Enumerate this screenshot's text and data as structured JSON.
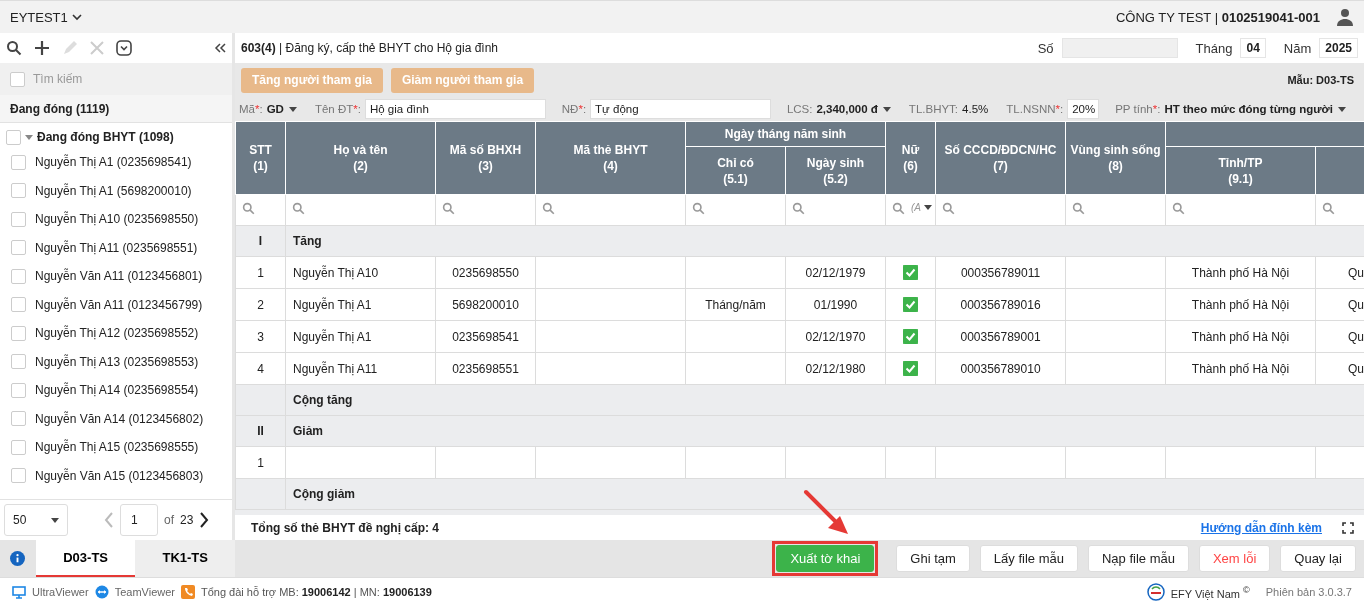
{
  "top_bar": {
    "account": "EYTEST1",
    "company": "CÔNG TY TEST | **0102519041-001**"
  },
  "sidebar": {
    "search": {
      "placeholder": "Tìm kiếm",
      "checked": false
    },
    "group_title": "Đang đóng (1119)",
    "tree": {
      "label": "Đang đóng BHYT (1098)",
      "checked": false,
      "expanded": true,
      "children": [
        {
          "label": "Nguyễn Thị A1 (0235698541)",
          "checked": false
        },
        {
          "label": "Nguyễn Thị A1 (5698200010)",
          "checked": false
        },
        {
          "label": "Nguyễn Thị A10 (0235698550)",
          "checked": false
        },
        {
          "label": "Nguyễn Thị A11 (0235698551)",
          "checked": false
        },
        {
          "label": "Nguyễn Văn A11 (0123456801)",
          "checked": false
        },
        {
          "label": "Nguyễn Văn A11 (0123456799)",
          "checked": false
        },
        {
          "label": "Nguyễn Thị A12 (0235698552)",
          "checked": false
        },
        {
          "label": "Nguyễn Thị A13 (0235698553)",
          "checked": false
        },
        {
          "label": "Nguyễn Thị A14 (0235698554)",
          "checked": false
        },
        {
          "label": "Nguyễn Văn A14 (0123456802)",
          "checked": false
        },
        {
          "label": "Nguyễn Thị A15 (0235698555)",
          "checked": false
        },
        {
          "label": "Nguyễn Văn A15 (0123456803)",
          "checked": false
        }
      ]
    },
    "pagination": {
      "page_size": "50",
      "page": "1",
      "of": "of",
      "total_pages": "23"
    },
    "tabs": [
      {
        "label": "D03-TS",
        "selected": true
      },
      {
        "label": "TK1-TS",
        "selected": false
      }
    ]
  },
  "form": {
    "title": "**603(4)** | Đăng ký, cấp thẻ BHYT cho Hộ gia đình",
    "period": [
      {
        "label": "Số"
      },
      {
        "label": "Tháng",
        "value": "04"
      },
      {
        "label": "Năm",
        "value": "2025"
      }
    ],
    "actions": [
      "Tăng người tham gia",
      "Giảm người tham gia"
    ],
    "template": "Mẫu: D03-TS",
    "params": [
      {
        "label": "Mã",
        "mark": "*",
        "suffix": ":",
        "kind": "select",
        "value": "GD"
      },
      {
        "label": "Tên ĐT",
        "mark": "*",
        "suffix": ":",
        "kind": "input",
        "value": "Hộ gia đình"
      },
      {
        "label": "NĐ",
        "mark": "*",
        "suffix": ":",
        "kind": "input",
        "value": "Tự động"
      },
      {
        "label": "LCS:",
        "kind": "select",
        "value": "2,340,000 đ"
      },
      {
        "label": "TL.BHYT:",
        "kind": "text",
        "value": "4.5%"
      },
      {
        "label": "TL.NSNN",
        "mark": "*",
        "suffix": ":",
        "kind": "small_input",
        "value": "20%"
      },
      {
        "label": "PP tính",
        "mark": "*",
        "suffix": ":",
        "kind": "select",
        "value": "HT theo mức đóng từng người"
      }
    ]
  },
  "table": {
    "columns": [
      {
        "label": "STT",
        "number": "(1)"
      },
      {
        "label": "Họ và tên",
        "number": "(2)"
      },
      {
        "label": "Mã số BHXH",
        "number": "(3)"
      },
      {
        "label": "Mã thẻ BHYT",
        "number": "(4)"
      },
      {
        "label": "Ngày tháng năm sinh",
        "children": [
          {
            "label": "Chỉ có",
            "number": "(5.1)"
          },
          {
            "label": "Ngày sinh",
            "number": "(5.2)"
          }
        ]
      },
      {
        "label": "Nữ",
        "number": "(6)",
        "filter": "(A"
      },
      {
        "label": "Số CCCD/ĐDCN/HC",
        "number": "(7)"
      },
      {
        "label": "Vùng sinh sống",
        "number": "(8)"
      },
      {
        "children": [
          {
            "label": "Tỉnh/TP",
            "number": "(9.1)"
          }
        ],
        "cut_off": true
      }
    ],
    "rows": [
      {
        "kind": "section",
        "stt": "I",
        "label": "Tăng"
      },
      {
        "kind": "row",
        "stt": "1",
        "name": "Nguyễn Thị A10",
        "bhxh": "0235698550",
        "birth_date": "02/12/1979",
        "female": true,
        "id_number": "000356789011",
        "province": "Thành phố Hà Nội",
        "column_11": "Qu"
      },
      {
        "kind": "row",
        "stt": "2",
        "name": "Nguyễn Thị A1",
        "bhxh": "5698200010",
        "birth_partial": "Tháng/năm",
        "birth_date": "01/1990",
        "female": true,
        "id_number": "000356789016",
        "province": "Thành phố Hà Nội",
        "column_11": "Qu"
      },
      {
        "kind": "row",
        "stt": "3",
        "name": "Nguyễn Thị A1",
        "bhxh": "0235698541",
        "birth_date": "02/12/1970",
        "female": true,
        "id_number": "000356789001",
        "province": "Thành phố Hà Nội",
        "column_11": "Qu"
      },
      {
        "kind": "row",
        "stt": "4",
        "name": "Nguyễn Thị A11",
        "bhxh": "0235698551",
        "birth_date": "02/12/1980",
        "female": true,
        "id_number": "000356789010",
        "province": "Thành phố Hà Nội",
        "column_11": "Qu"
      },
      {
        "kind": "total",
        "label": "Cộng tăng"
      },
      {
        "kind": "section",
        "stt": "II",
        "label": "Giảm"
      },
      {
        "kind": "row",
        "stt": "1"
      },
      {
        "kind": "total",
        "label": "Cộng giảm"
      }
    ],
    "summary": "Tổng số thẻ BHYT đề nghị cấp: 4",
    "help_link": "Hướng dẫn đính kèm"
  },
  "buttons": [
    {
      "label": "Xuất tờ khai",
      "kind": "primary",
      "highlighted": true
    },
    {
      "label": "Ghi tạm",
      "kind": "default"
    },
    {
      "label": "Lấy file mẫu",
      "kind": "default"
    },
    {
      "label": "Nạp file mẫu",
      "kind": "default"
    },
    {
      "label": "Xem lỗi",
      "kind": "danger"
    },
    {
      "label": "Quay lại",
      "kind": "default"
    }
  ],
  "status_bar": {
    "tools": [
      "UltraViewer",
      "TeamViewer"
    ],
    "hotline": "Tổng đài hỗ trợ MB: **19006142** | MN: **19006139**",
    "brand": "EFY Việt Nam $^{©}$",
    "version": "Phiên bản 3.0.3.7"
  }
}
